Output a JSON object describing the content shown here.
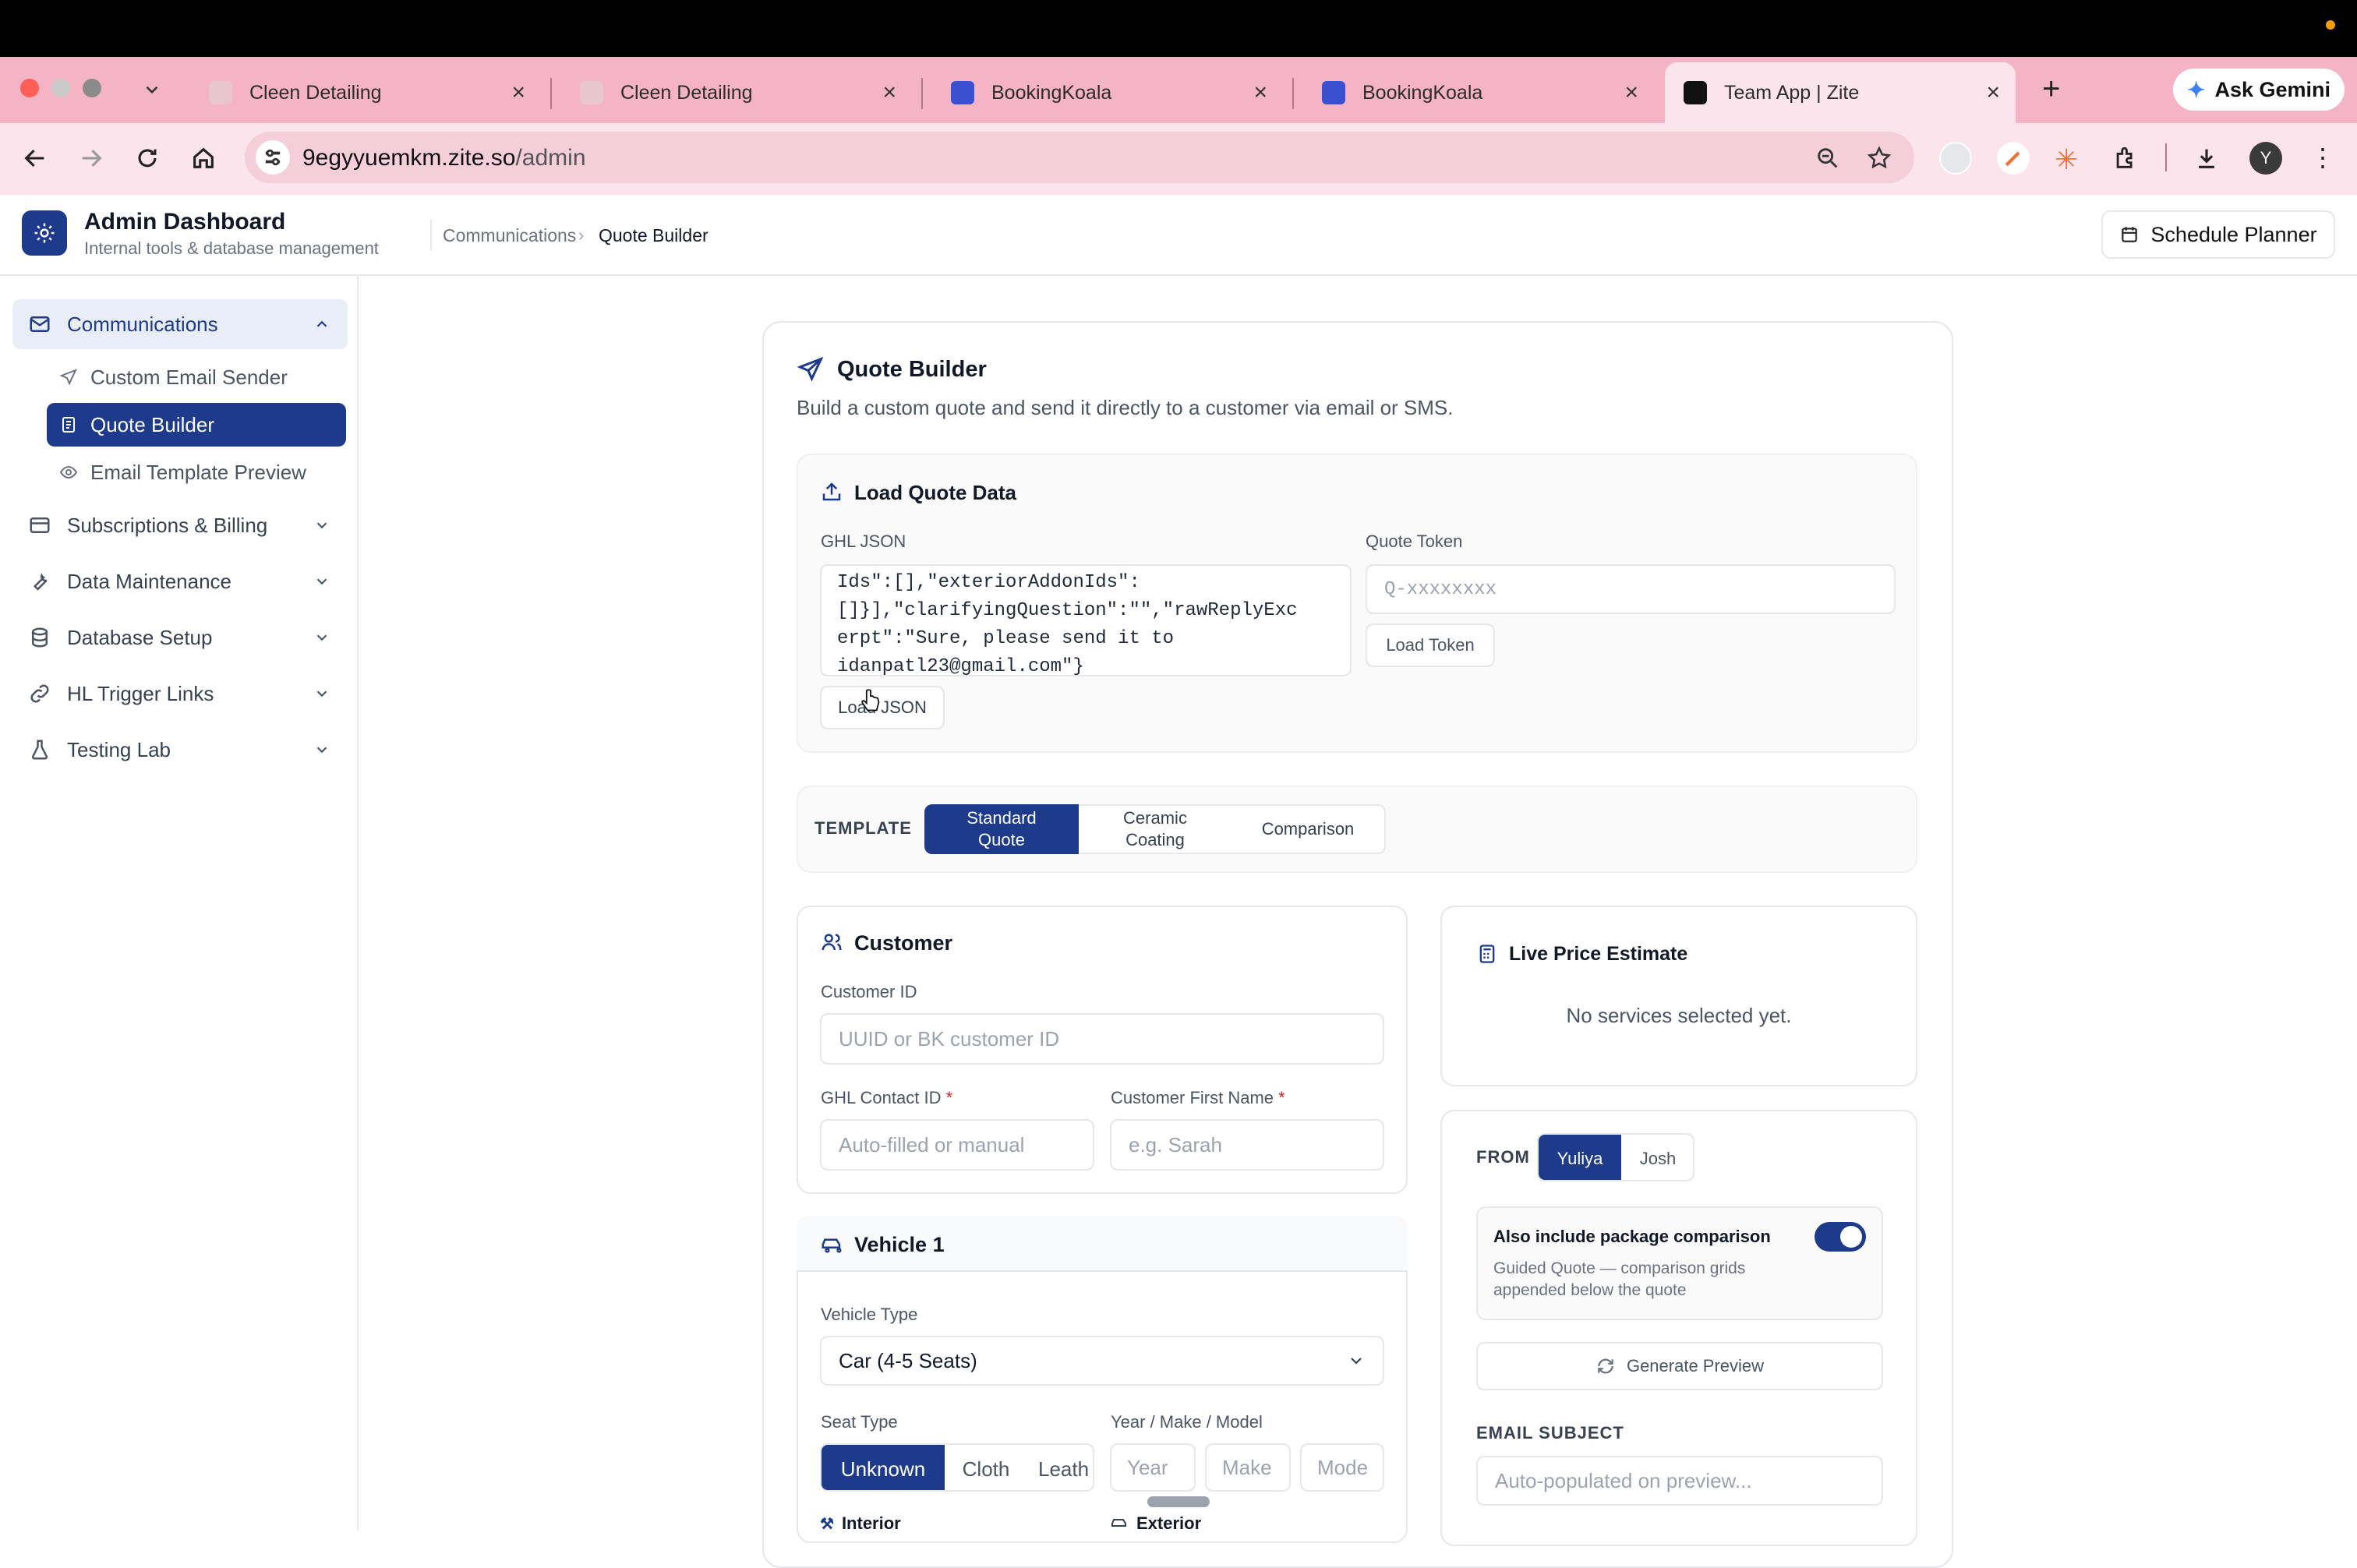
{
  "browser": {
    "tabs": [
      {
        "label": "Cleen Detailing"
      },
      {
        "label": "Cleen Detailing"
      },
      {
        "label": "BookingKoala"
      },
      {
        "label": "BookingKoala"
      },
      {
        "label": "Team App | Zite"
      }
    ],
    "ask_gemini": "Ask Gemini",
    "url_host": "9egyyuemkm.zite.so",
    "url_path": "/admin",
    "profile_initial": "Y"
  },
  "header": {
    "title": "Admin Dashboard",
    "subtitle": "Internal tools & database management",
    "breadcrumb": [
      "Communications",
      "Quote Builder"
    ],
    "schedule_planner": "Schedule Planner"
  },
  "sidebar": {
    "communications": "Communications",
    "sub_items": [
      "Custom Email Sender",
      "Quote Builder",
      "Email Template Preview"
    ],
    "items": [
      "Subscriptions & Billing",
      "Data Maintenance",
      "Database Setup",
      "HL Trigger Links",
      "Testing Lab"
    ]
  },
  "quote_builder": {
    "title": "Quote Builder",
    "subtitle": "Build a custom quote and send it directly to a customer via email or SMS.",
    "load": {
      "title": "Load Quote Data",
      "ghl_json_label": "GHL JSON",
      "ghl_json_value": "Ids\":[],\"exteriorAddonIds\":\n[]}],\"clarifyingQuestion\":\"\",\"rawReplyExc\nerpt\":\"Sure, please send it to\nidanpatl23@gmail.com\"}",
      "load_json": "Load JSON",
      "quote_token_label": "Quote Token",
      "quote_token_placeholder": "Q-xxxxxxxx",
      "load_token": "Load Token"
    },
    "template": {
      "label": "TEMPLATE",
      "options": [
        "Standard Quote",
        "Ceramic Coating",
        "Comparison"
      ],
      "selected": "Standard Quote"
    },
    "customer": {
      "title": "Customer",
      "customer_id_label": "Customer ID",
      "customer_id_placeholder": "UUID or BK customer ID",
      "ghl_contact_label": "GHL Contact ID",
      "ghl_contact_placeholder": "Auto-filled or manual",
      "first_name_label": "Customer First Name",
      "first_name_placeholder": "e.g. Sarah",
      "required_mark": "*"
    },
    "vehicle": {
      "title": "Vehicle 1",
      "type_label": "Vehicle Type",
      "type_value": "Car (4-5 Seats)",
      "seat_label": "Seat Type",
      "seat_options": [
        "Unknown",
        "Cloth",
        "Leath"
      ],
      "seat_selected": "Unknown",
      "ymm_label": "Year / Make / Model",
      "year_placeholder": "Year",
      "make_placeholder": "Make",
      "model_placeholder": "Mode",
      "interior_label": "Interior",
      "exterior_label": "Exterior"
    },
    "estimate": {
      "title": "Live Price Estimate",
      "empty": "No services selected yet."
    },
    "send": {
      "from_label": "FROM",
      "from_options": [
        "Yuliya",
        "Josh"
      ],
      "from_selected": "Yuliya",
      "comparison_title": "Also include package comparison",
      "comparison_desc": "Guided Quote — comparison grids appended below the quote",
      "comparison_enabled": true,
      "generate_preview": "Generate Preview",
      "subject_label": "EMAIL SUBJECT",
      "subject_placeholder": "Auto-populated on preview..."
    }
  },
  "colors": {
    "primary": "#1e3a8a",
    "tab_strip": "#f5b4c6",
    "toolbar": "#fce4ec",
    "required": "#dc2626"
  }
}
